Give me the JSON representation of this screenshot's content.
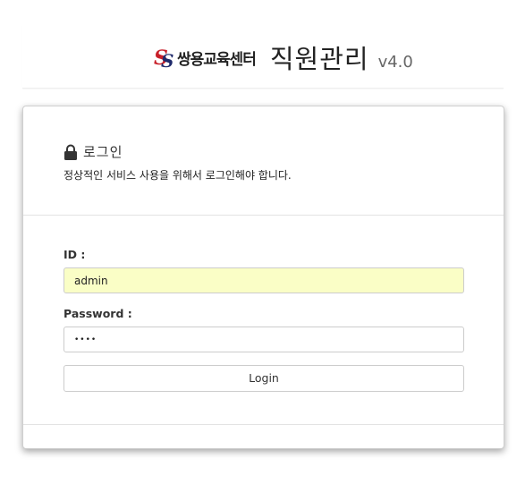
{
  "header": {
    "logo_text": "쌍용교육센터",
    "title": "직원관리",
    "version": "v4.0"
  },
  "login": {
    "heading": "로그인",
    "description": "정상적인 서비스 사용을 위해서 로그인해야 합니다.",
    "id_label": "ID :",
    "id_value": "admin",
    "password_label": "Password :",
    "password_masked": "••••",
    "button_label": "Login"
  },
  "colors": {
    "autofill_bg": "#fafec6",
    "logo_red": "#c8202a"
  },
  "icons": [
    "lock-icon",
    "logo-mark-icon"
  ]
}
